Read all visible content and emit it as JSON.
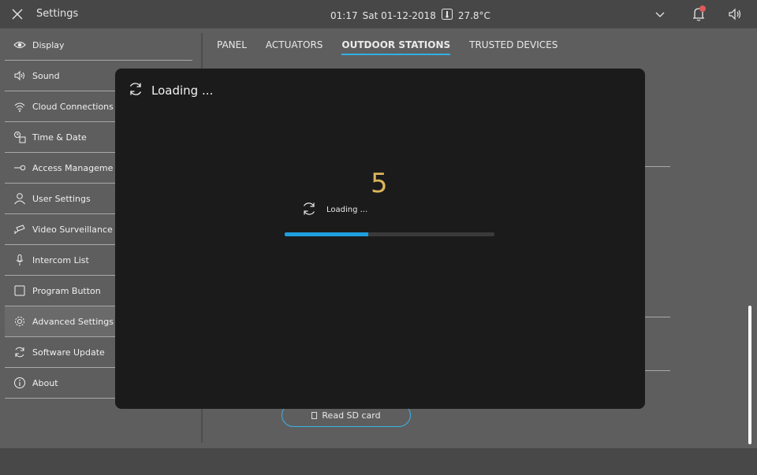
{
  "header": {
    "title": "Settings",
    "time": "01:17",
    "date": "Sat 01-12-2018",
    "temperature": "27.8°C",
    "notification_color": "#e05a5a"
  },
  "sidebar": {
    "items": [
      {
        "label": "Display",
        "icon": "eye-icon"
      },
      {
        "label": "Sound",
        "icon": "speaker-icon"
      },
      {
        "label": "Cloud Connections",
        "icon": "wifi-icon"
      },
      {
        "label": "Time & Date",
        "icon": "clock-calendar-icon"
      },
      {
        "label": "Access Manageme",
        "icon": "key-icon"
      },
      {
        "label": "User Settings",
        "icon": "user-icon"
      },
      {
        "label": "Video Surveillance",
        "icon": "camera-icon"
      },
      {
        "label": "Intercom List",
        "icon": "microphone-icon"
      },
      {
        "label": "Program Button",
        "icon": "square-icon"
      },
      {
        "label": "Advanced Settings",
        "icon": "gear-icon",
        "active": true
      },
      {
        "label": "Software Update",
        "icon": "refresh-icon"
      },
      {
        "label": "About",
        "icon": "info-icon"
      }
    ]
  },
  "tabs": [
    {
      "label": "PANEL"
    },
    {
      "label": "ACTUATORS"
    },
    {
      "label": "OUTDOOR STATIONS",
      "active": true
    },
    {
      "label": "TRUSTED DEVICES"
    }
  ],
  "content": {
    "sd_button_label": "Read SD card"
  },
  "modal": {
    "title": "Loading ...",
    "countdown": "5",
    "status": "Loading ...",
    "progress": 0.4,
    "accent_color": "#1f9fe0",
    "countdown_color": "#dbb559"
  }
}
